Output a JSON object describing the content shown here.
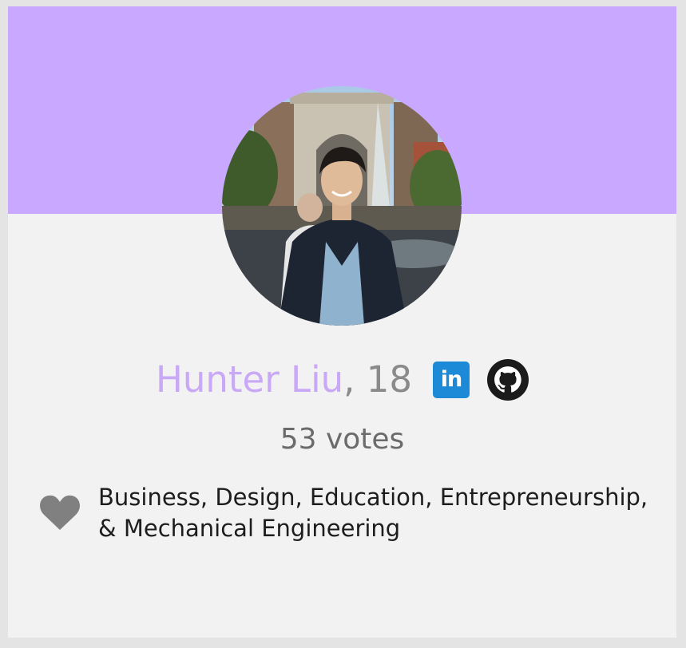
{
  "card": {
    "banner_color": "#c9a8ff",
    "profile": {
      "name": "Hunter Liu",
      "age_suffix": ", 18",
      "votes_text": "53 votes",
      "linkedin_text": "in",
      "linkedin_color": "#1c8ad6",
      "interests_line1": "Business, Design, Education, Entrepreneurship,",
      "interests_line2": "& Mechanical Engineering"
    },
    "icons": {
      "avatar": "profile-photo",
      "linkedin": "linkedin-icon",
      "github": "github-icon",
      "interests": "heart-icon"
    }
  }
}
